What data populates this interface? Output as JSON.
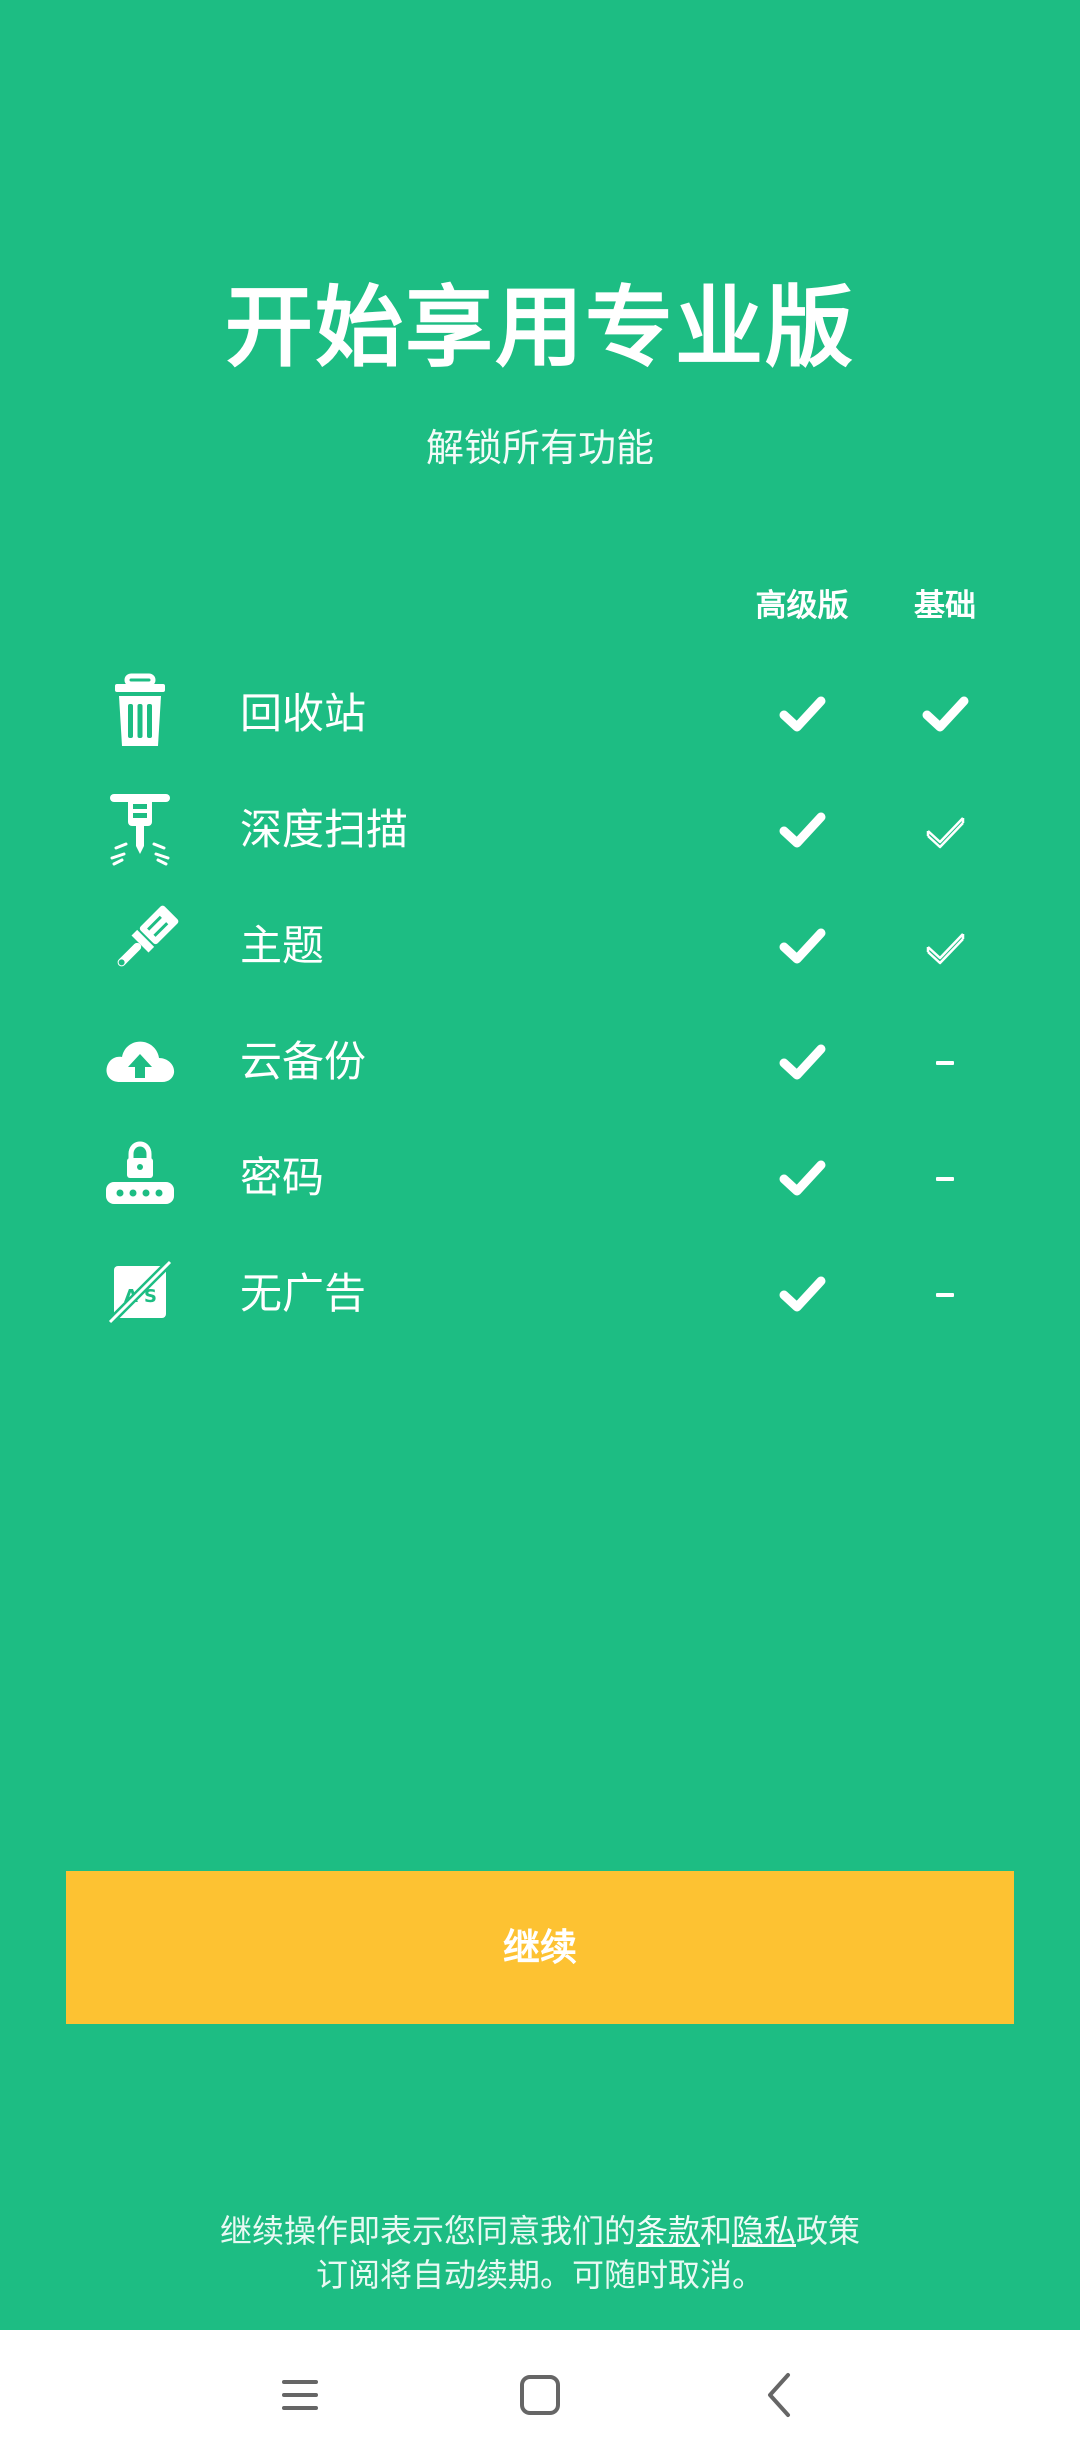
{
  "header": {
    "title": "开始享用专业版",
    "subtitle": "解锁所有功能"
  },
  "table": {
    "columns": [
      "高级版",
      "基础"
    ],
    "features": [
      {
        "icon": "trash-can-icon",
        "label": "回收站",
        "premium": "check",
        "basic": "check"
      },
      {
        "icon": "jackhammer-icon",
        "label": "深度扫描",
        "premium": "check",
        "basic": "check-outline"
      },
      {
        "icon": "paint-brush-icon",
        "label": "主题",
        "premium": "check",
        "basic": "check-outline"
      },
      {
        "icon": "cloud-upload-icon",
        "label": "云备份",
        "premium": "check",
        "basic": "dash"
      },
      {
        "icon": "password-lock-icon",
        "label": "密码",
        "premium": "check",
        "basic": "dash"
      },
      {
        "icon": "no-ads-icon",
        "label": "无广告",
        "premium": "check",
        "basic": "dash"
      }
    ]
  },
  "cta": {
    "continue_label": "继续"
  },
  "legal": {
    "line1_prefix": "继续操作即表示您同意我们的",
    "terms_link": "条款",
    "and": "和",
    "privacy_link": "隐私",
    "line1_suffix": "政策",
    "line2": "订阅将自动续期。可随时取消。"
  },
  "colors": {
    "background": "#1dbd83",
    "button": "#fdc232",
    "text": "#ffffff"
  }
}
